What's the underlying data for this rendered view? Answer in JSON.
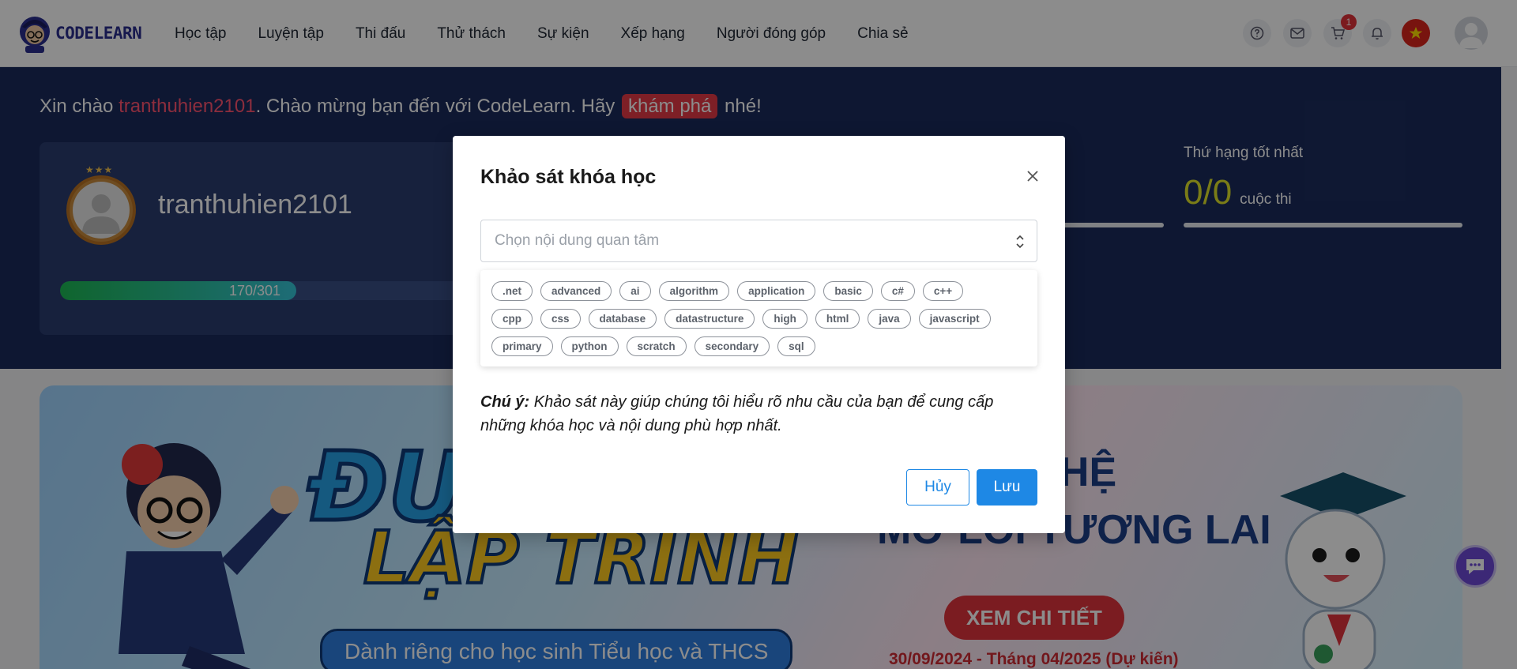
{
  "brand": {
    "logo_text": "CODELEARN"
  },
  "nav": {
    "items": [
      {
        "label": "Học tập"
      },
      {
        "label": "Luyện tập"
      },
      {
        "label": "Thi đấu"
      },
      {
        "label": "Thử thách"
      },
      {
        "label": "Sự kiện"
      },
      {
        "label": "Xếp hạng"
      },
      {
        "label": "Người đóng góp"
      },
      {
        "label": "Chia sẻ"
      }
    ],
    "cart_count": "1",
    "icons": [
      "help-icon",
      "mail-icon",
      "cart-icon",
      "bell-icon",
      "flag-vietnam-icon",
      "user-avatar-icon"
    ]
  },
  "hero": {
    "greeting_prefix": "Xin chào ",
    "username": "tranthuhien2101",
    "greeting_middle": ". Chào mừng bạn đến với CodeLearn. Hãy ",
    "explore": "khám phá",
    "greeting_suffix": " nhé!",
    "profile_name": "tranthuhien2101",
    "xp_text": "170/301",
    "xp_fraction": 0.565,
    "best_rank_label": "Thứ hạng tốt nhất",
    "best_rank_value": "0/0",
    "best_rank_unit": "cuộc thi"
  },
  "banner": {
    "title_line1": "ĐƯỜ",
    "title_line2": "LẬP TRÌNH",
    "subtitle": "Dành riêng cho học sinh Tiểu học và THCS",
    "right_line1": "ÔNG NGHỆ",
    "right_line2": "MỞ LỐI TƯƠNG LAI",
    "cta": "XEM CHI TIẾT",
    "date": "30/09/2024 - Tháng 04/2025 (Dự kiến)"
  },
  "modal": {
    "title": "Khảo sát khóa học",
    "select_placeholder": "Chọn nội dung quan tâm",
    "tags_row1": [
      ".net",
      "advanced",
      "ai",
      "algorithm",
      "application",
      "basic",
      "c#",
      "c++"
    ],
    "tags_row2": [
      "cpp",
      "css",
      "database",
      "datastructure",
      "high",
      "html",
      "java",
      "javascript"
    ],
    "tags_row3": [
      "primary",
      "python",
      "scratch",
      "secondary",
      "sql"
    ],
    "note_label": "Chú ý:",
    "note_text": " Khảo sát này giúp chúng tôi hiểu rõ nhu cầu của bạn để cung cấp những khóa học và nội dung phù hợp nhất.",
    "cancel_label": "Hủy",
    "save_label": "Lưu"
  },
  "colors": {
    "primary": "#1e88e5",
    "hero_bg": "#1b2b5c",
    "accent_red": "#e53946",
    "rank_yellow": "#dfe22a"
  }
}
